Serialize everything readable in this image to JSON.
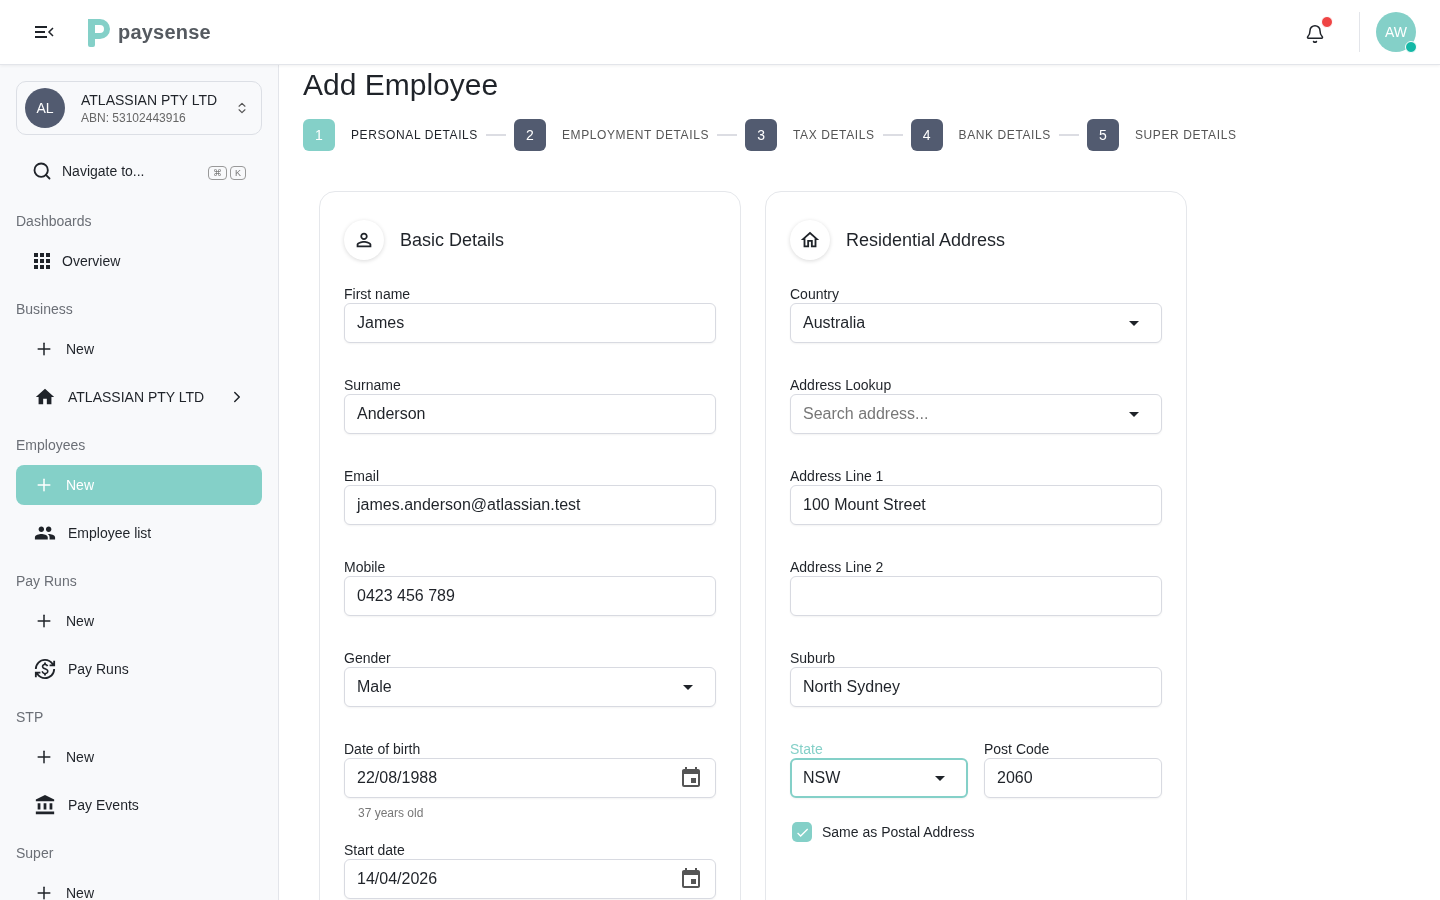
{
  "header": {
    "brand": "paysense",
    "notifications": {
      "unread": true
    },
    "user": {
      "initials": "AW",
      "online": true
    }
  },
  "sidebar": {
    "company": {
      "initials": "AL",
      "name": "ATLASSIAN PTY LTD",
      "abn": "ABN: 53102443916"
    },
    "navigate": {
      "label": "Navigate to...",
      "keys": [
        "⌘",
        "K"
      ]
    },
    "sections": [
      {
        "title": "Dashboards",
        "items": [
          {
            "label": "Overview",
            "kind": "overview",
            "selected": false
          }
        ]
      },
      {
        "title": "Business",
        "items": [
          {
            "label": "New",
            "kind": "add",
            "selected": false
          },
          {
            "label": "ATLASSIAN PTY LTD",
            "kind": "company",
            "selected": false
          }
        ]
      },
      {
        "title": "Employees",
        "items": [
          {
            "label": "New",
            "kind": "add",
            "selected": true
          },
          {
            "label": "Employee list",
            "kind": "people",
            "selected": false
          }
        ]
      },
      {
        "title": "Pay Runs",
        "items": [
          {
            "label": "New",
            "kind": "add",
            "selected": false
          },
          {
            "label": "Pay Runs",
            "kind": "payruns",
            "selected": false
          }
        ]
      },
      {
        "title": "STP",
        "items": [
          {
            "label": "New",
            "kind": "add",
            "selected": false
          },
          {
            "label": "Pay Events",
            "kind": "events",
            "selected": false
          }
        ]
      },
      {
        "title": "Super",
        "items": [
          {
            "label": "New",
            "kind": "add",
            "selected": false
          }
        ]
      }
    ]
  },
  "page": {
    "title": "Add Employee"
  },
  "steps": [
    {
      "number": "1",
      "label": "PERSONAL DETAILS",
      "selected": true
    },
    {
      "number": "2",
      "label": "EMPLOYMENT DETAILS",
      "selected": false
    },
    {
      "number": "3",
      "label": "TAX DETAILS",
      "selected": false
    },
    {
      "number": "4",
      "label": "BANK DETAILS",
      "selected": false
    },
    {
      "number": "5",
      "label": "SUPER DETAILS",
      "selected": false
    }
  ],
  "basic_details": {
    "title": "Basic Details",
    "fields": [
      {
        "label": "First name",
        "kind": "text",
        "value": "James",
        "focused": false
      },
      {
        "label": "Surname",
        "kind": "text",
        "value": "Anderson",
        "focused": false
      },
      {
        "label": "Email",
        "kind": "text",
        "value": "james.anderson@atlassian.test",
        "focused": false
      },
      {
        "label": "Mobile",
        "kind": "text",
        "value": "0423 456 789",
        "focused": false
      },
      {
        "label": "Gender",
        "kind": "select",
        "value": "Male",
        "focused": false
      },
      {
        "label": "Date of birth",
        "kind": "date",
        "value": "22/08/1988",
        "helper": "37 years old",
        "focused": false
      },
      {
        "label": "Start date",
        "kind": "date",
        "value": "14/04/2026",
        "focused": false
      }
    ]
  },
  "residential_address": {
    "title": "Residential Address",
    "fields": [
      {
        "label": "Country",
        "kind": "select",
        "value": "Australia",
        "focused": false
      },
      {
        "label": "Address Lookup",
        "kind": "select",
        "placeholder": "Search address...",
        "focused": false
      },
      {
        "label": "Address Line 1",
        "kind": "text",
        "value": "100 Mount Street",
        "focused": false
      },
      {
        "label": "Address Line 2",
        "kind": "text",
        "focused": false
      },
      {
        "label": "Suburb",
        "kind": "text",
        "value": "North Sydney",
        "focused": false
      }
    ],
    "inline_fields": [
      {
        "label": "State",
        "kind": "select",
        "value": "NSW",
        "focused": true
      },
      {
        "label": "Post Code",
        "kind": "text",
        "value": "2060",
        "focused": false
      }
    ],
    "checkbox": {
      "label": "Same as Postal Address",
      "checked": true
    }
  }
}
